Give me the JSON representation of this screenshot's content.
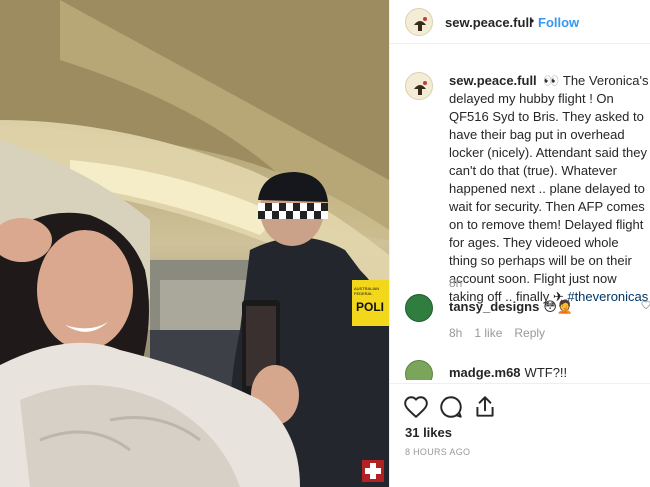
{
  "post": {
    "username": "sew.peace.full",
    "separator": "•",
    "follow_label": "Follow"
  },
  "caption": {
    "username": "sew.peace.full",
    "emoji": "👀",
    "text": "The Veronica's delayed my hubby flight ! On QF516 Syd to Bris. They asked to have their bag put in overhead locker (nicely). Attendant said they can't do that (true). Whatever happened next .. plane delayed to wait for security. Then AFP comes on to remove them! Delayed flight for ages. They videoed whole thing so perhaps will be on their account soon. Flight just now taking off .. finally ✈",
    "hashtag": "#theveronicas",
    "time": "8h"
  },
  "comments": [
    {
      "username": "tansy_designs",
      "text": "😳🤦",
      "time": "8h",
      "likes": "1 like",
      "reply": "Reply",
      "avatar_color": "#2f7d3f"
    },
    {
      "username": "madge.m68",
      "text": "WTF?!!",
      "avatar_color": "#7aa55a"
    }
  ],
  "actions": {
    "like_icon": "heart-icon",
    "comment_icon": "speech-bubble-icon",
    "share_icon": "share-icon",
    "likes_count": "31 likes",
    "timestamp": "8 HOURS AGO"
  },
  "photo": {
    "badge_text": "POLI",
    "badge_small_text": "AUSTRALIAN FEDERAL"
  }
}
